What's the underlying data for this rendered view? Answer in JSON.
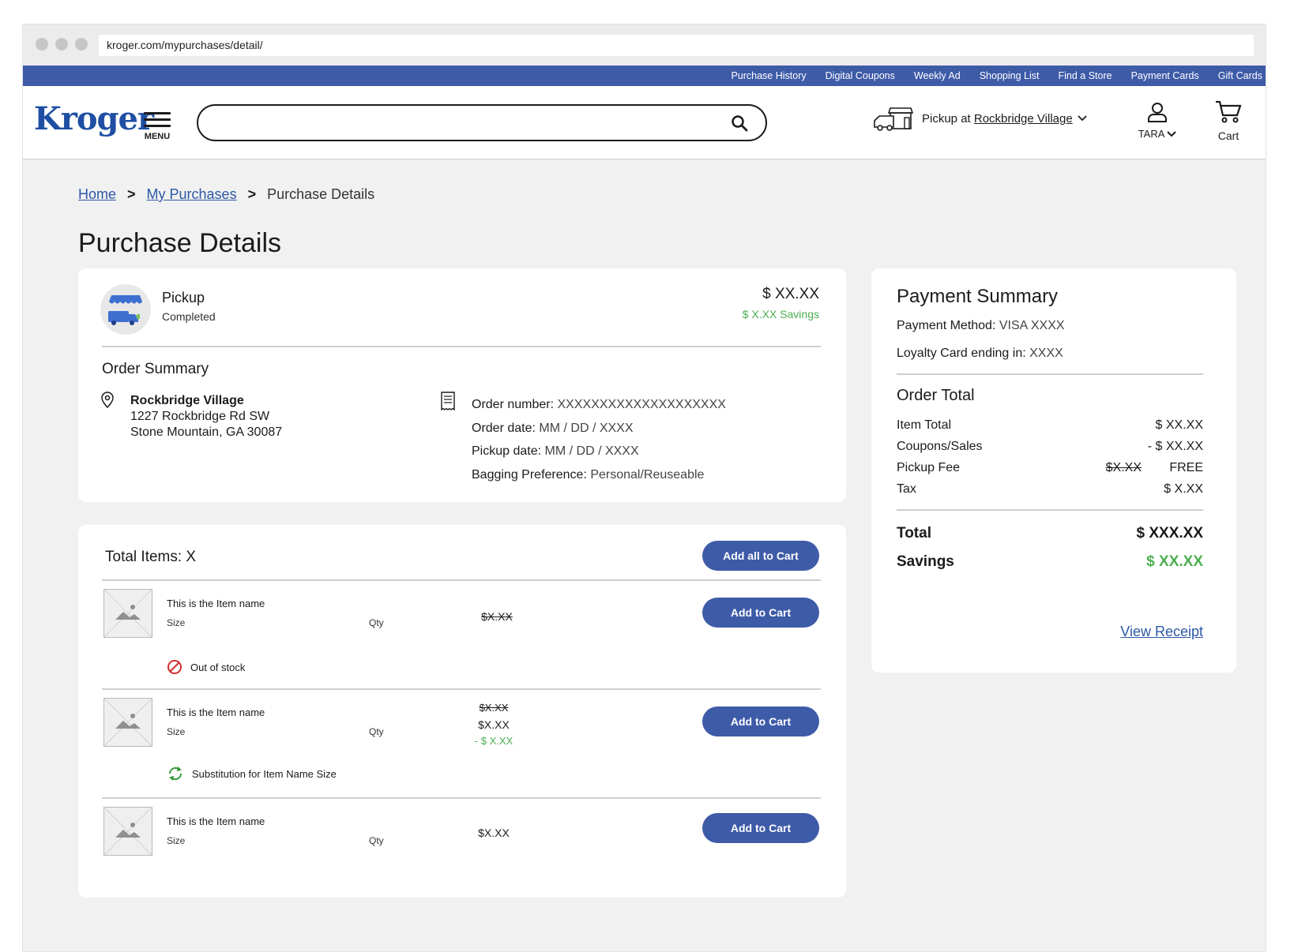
{
  "browser": {
    "url": "kroger.com/mypurchases/detail/"
  },
  "top_nav": [
    "Purchase History",
    "Digital Coupons",
    "Weekly Ad",
    "Shopping List",
    "Find a Store",
    "Payment Cards",
    "Gift Cards"
  ],
  "header": {
    "logo": "Kroger",
    "menu_label": "MENU",
    "search_placeholder": "",
    "pickup_prefix": "Pickup at",
    "pickup_store": "Rockbridge Village",
    "user_label": "TARA",
    "cart_label": "Cart"
  },
  "breadcrumb": {
    "home": "Home",
    "purchases": "My Purchases",
    "current": "Purchase Details"
  },
  "page_title": "Purchase Details",
  "pickup_card": {
    "title": "Pickup",
    "status": "Completed",
    "amount": "$ XX.XX",
    "savings": "$ X.XX Savings"
  },
  "order_summary": {
    "title": "Order Summary",
    "store_name": "Rockbridge Village",
    "address_line1": "1227 Rockbridge Rd SW",
    "address_line2": "Stone Mountain, GA 30087",
    "order_number_label": "Order number:",
    "order_number": "XXXXXXXXXXXXXXXXXXXX",
    "order_date_label": "Order date:",
    "order_date": "MM / DD / XXXX",
    "pickup_date_label": "Pickup date:",
    "pickup_date": "MM / DD / XXXX",
    "bagging_label": "Bagging Preference:",
    "bagging": "Personal/Reuseable"
  },
  "items_card": {
    "total_label": "Total Items: X",
    "add_all_label": "Add all to Cart",
    "add_label": "Add to Cart",
    "items": [
      {
        "name": "This is the Item name",
        "size": "Size",
        "qty": "Qty",
        "price_strike": "$X.XX",
        "note": "Out of stock"
      },
      {
        "name": "This is the Item name",
        "size": "Size",
        "qty": "Qty",
        "price_strike": "$X.XX",
        "price": "$X.XX",
        "discount": "- $ X.XX",
        "note": "Substitution for Item Name Size"
      },
      {
        "name": "This is the Item name",
        "size": "Size",
        "qty": "Qty",
        "price": "$X.XX"
      }
    ]
  },
  "payment_summary": {
    "title": "Payment Summary",
    "method_label": "Payment Method:",
    "method": "VISA XXXX",
    "loyalty_label": "Loyalty Card ending in:",
    "loyalty": "XXXX",
    "order_total_title": "Order Total",
    "item_total_label": "Item Total",
    "item_total": "$ XX.XX",
    "coupons_label": "Coupons/Sales",
    "coupons": "- $ XX.XX",
    "pickup_fee_label": "Pickup Fee",
    "pickup_fee_strike": "$X.XX",
    "pickup_fee": "FREE",
    "tax_label": "Tax",
    "tax": "$ X.XX",
    "total_label": "Total",
    "total": "$ XXX.XX",
    "savings_label": "Savings",
    "savings": "$ XX.XX",
    "receipt_link": "View Receipt"
  },
  "colors": {
    "brand_blue": "#3e5ba8",
    "link_blue": "#2e58a6",
    "savings_green": "#4caf50",
    "error_red": "#d32f2f"
  }
}
